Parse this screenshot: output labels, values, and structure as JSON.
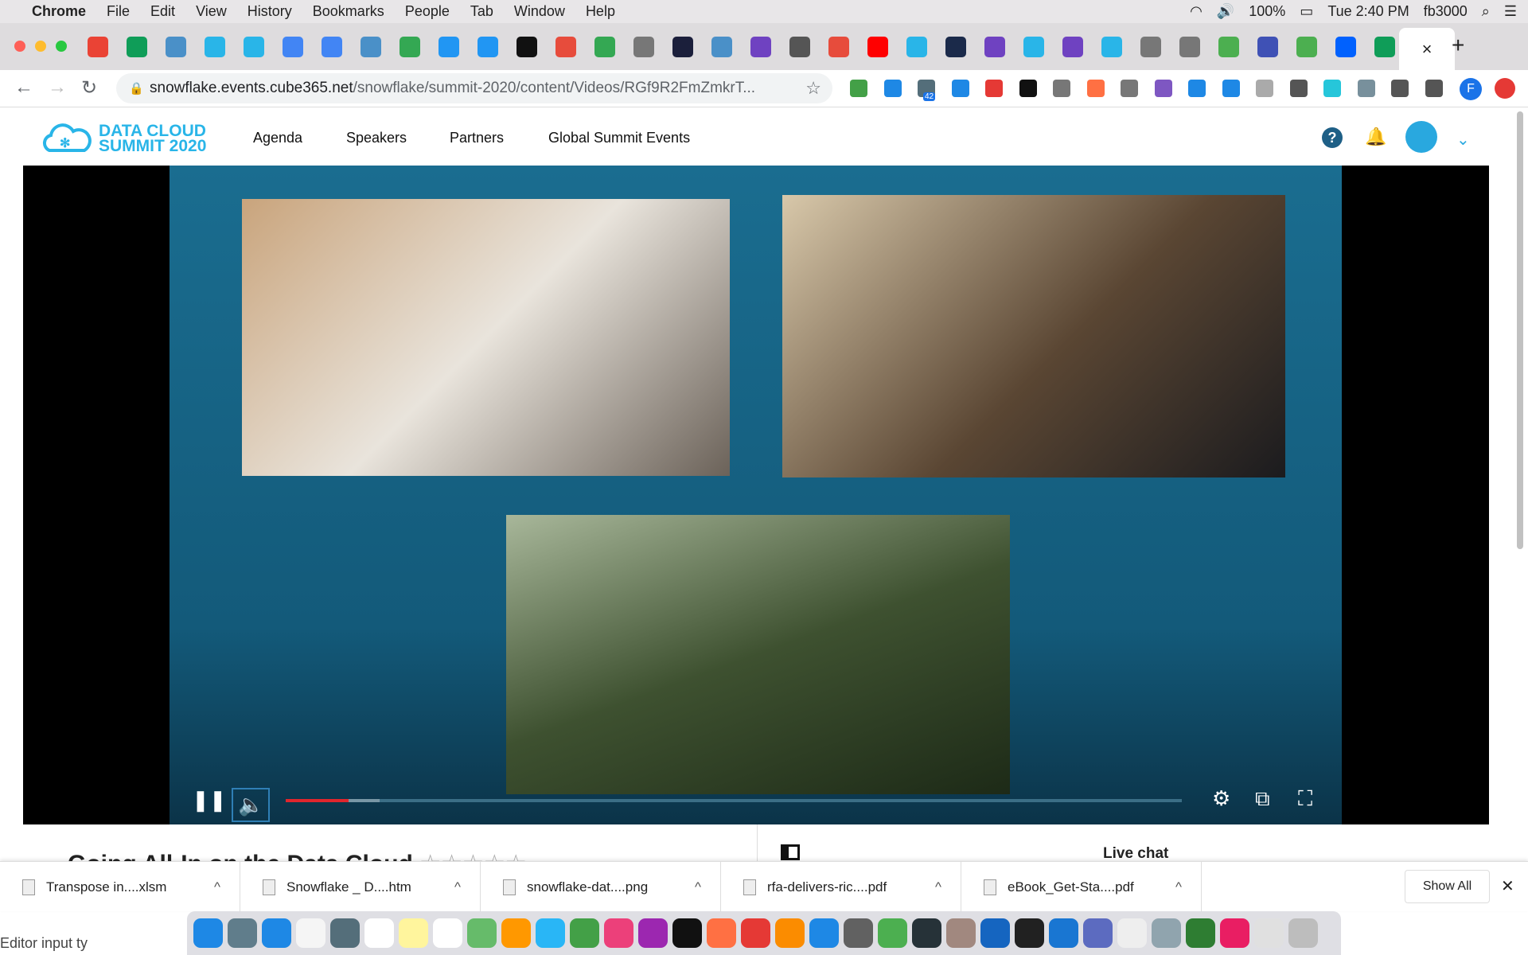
{
  "menubar": {
    "app": "Chrome",
    "items": [
      "File",
      "Edit",
      "View",
      "History",
      "Bookmarks",
      "People",
      "Tab",
      "Window",
      "Help"
    ],
    "battery": "100%",
    "clock": "Tue 2:40 PM",
    "user": "fb3000"
  },
  "tabs": {
    "icon_colors": [
      "#ea4335",
      "#0f9d58",
      "#4a90c8",
      "#29b5e8",
      "#29b5e8",
      "#4285f4",
      "#4285f4",
      "#4a90c8",
      "#34a853",
      "#2196f3",
      "#2196f3",
      "#111111",
      "#e74c3c",
      "#34a853",
      "#777777",
      "#1b1f3b",
      "#4a90c8",
      "#6f42c1",
      "#555555",
      "#e74c3c",
      "#ff0000",
      "#29b5e8",
      "#1b2a4a",
      "#6f42c1",
      "#29b5e8",
      "#6f42c1",
      "#29b5e8",
      "#777777",
      "#777777",
      "#4caf50",
      "#3f51b5",
      "#4caf50",
      "#0061fe",
      "#0f9d58"
    ],
    "close": "×",
    "new_tab": "+"
  },
  "address": {
    "domain": "snowflake.events.cube365.net",
    "path": "/snowflake/summit-2020/content/Videos/RGf9R2FmZmkrT...",
    "ext_badge": "42",
    "profile": "F"
  },
  "site": {
    "logo_line1": "DATA CLOUD",
    "logo_line2": "SUMMIT 2020",
    "nav": [
      "Agenda",
      "Speakers",
      "Partners",
      "Global Summit Events"
    ]
  },
  "video": {
    "progress_percent": 7,
    "buffered_percent": 10.5,
    "colors": {
      "stage": "#1a6d90",
      "played": "#e0262d"
    }
  },
  "below": {
    "title": "Going All-In on the Data Cloud",
    "rating_stars": 5,
    "live_chat": "Live chat"
  },
  "downloads": {
    "items": [
      "Transpose in....xlsm",
      "Snowflake _ D....htm",
      "snowflake-dat....png",
      "rfa-delivers-ric....pdf",
      "eBook_Get-Sta....pdf"
    ],
    "show_all": "Show All",
    "close": "✕"
  },
  "dock": {
    "icon_colors": [
      "#1e88e5",
      "#607d8b",
      "#1e88e5",
      "#f5f5f5",
      "#546e7a",
      "#ffffff",
      "#fff59d",
      "#ffffff",
      "#66bb6a",
      "#ff9800",
      "#29b6f6",
      "#43a047",
      "#ec407a",
      "#9c27b0",
      "#111111",
      "#ff7043",
      "#e53935",
      "#fb8c00",
      "#1e88e5",
      "#616161",
      "#4caf50",
      "#263238",
      "#a1887f",
      "#1565c0",
      "#212121",
      "#1976d2",
      "#5c6bc0",
      "#eeeeee",
      "#90a4ae",
      "#2e7d32",
      "#e91e63",
      "#e0e0e0",
      "#bdbdbd"
    ]
  },
  "status_hint": "Editor input ty"
}
